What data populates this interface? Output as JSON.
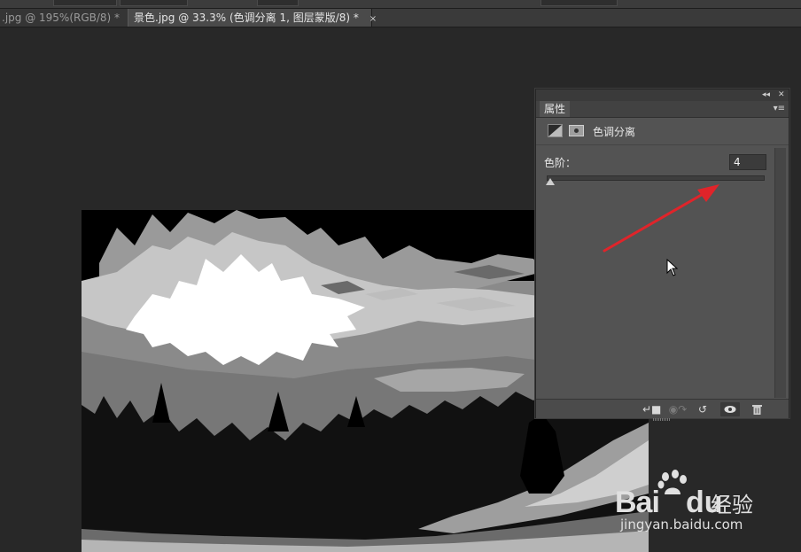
{
  "tabs": [
    {
      "label": ".jpg @ 195%(RGB/8) *",
      "active": false
    },
    {
      "label": "景色.jpg @ 33.3% (色调分离 1, 图层蒙版/8) *",
      "active": true
    }
  ],
  "tab_close_glyph": "×",
  "properties_panel": {
    "header_collapse_glyph": "◂◂",
    "header_close_glyph": "✕",
    "tab_label": "属性",
    "menu_glyph": "▾≡",
    "adjustment_title": "色调分离",
    "adjustment_icon": "posterize-adjustment-icon",
    "mask_icon": "layer-mask-icon",
    "levels_label": "色阶：",
    "levels_value": "4",
    "levels_slider_value": 4,
    "levels_slider_range": [
      2,
      255
    ],
    "footer_icons": [
      {
        "name": "clip-to-layer-icon",
        "glyph": "↵■"
      },
      {
        "name": "view-previous-state-icon",
        "glyph": "◉↷"
      },
      {
        "name": "reset-icon",
        "glyph": "↺"
      },
      {
        "name": "visibility-eye-icon",
        "glyph": "👁"
      },
      {
        "name": "delete-trash-icon",
        "glyph": "🗑"
      }
    ]
  },
  "annotation": {
    "color": "#e0242a",
    "type": "arrow"
  },
  "watermark": {
    "brand_left": "Bai",
    "brand_right": "du",
    "product": "经验",
    "url": "jingyan.baidu.com"
  }
}
